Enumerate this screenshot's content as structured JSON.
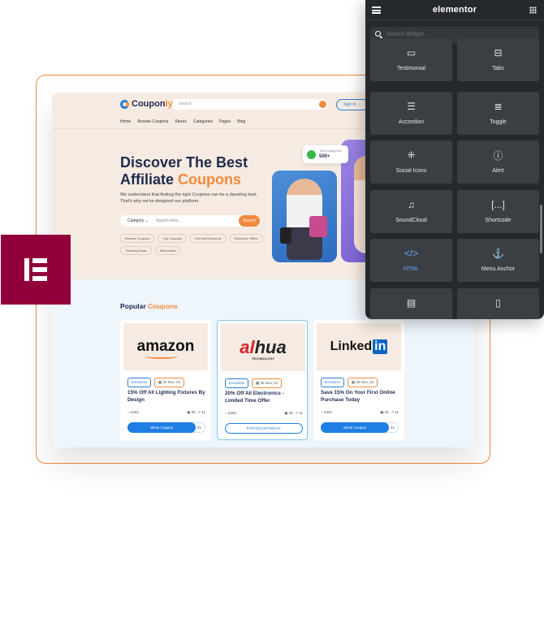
{
  "site": {
    "logo": {
      "text_main": "Coupon",
      "text_accent": "ly"
    },
    "search_placeholder": "Search",
    "signin_label": "Sign In",
    "menu": [
      "Home",
      "Browse Coupons",
      "Stores",
      "Categories",
      "Pages",
      "Blog"
    ],
    "hero": {
      "title_line1": "Discover The Best",
      "title_line2_main": "Affiliate",
      "title_line2_accent": "Coupons",
      "description": "We understand that finding the right Coupons can be a daunting task. That's why we've designed our platform.",
      "search_category": "Category",
      "search_placeholder": "Search here...",
      "search_button": "Search",
      "tags": [
        "Browse Coupons",
        "Top Coupons",
        "Hot and Discounts",
        "Exclusive Offers",
        "Trending Deals",
        "Best Deals"
      ],
      "stat": {
        "label": "Total categories",
        "value": "500+"
      }
    },
    "popular": {
      "title_main": "Popular",
      "title_accent": "Coupons"
    },
    "cards": [
      {
        "brand": "amazon",
        "badge": "Exclusive",
        "date": "25 Nov, 24",
        "title": "15% Off All Lighting Fixtures By Design",
        "uses": "5462",
        "likes": "25",
        "shares": "11",
        "button": "Show Coupon",
        "button_tail": "ifo"
      },
      {
        "brand_main": "hua",
        "brand_accent": "al",
        "brand_sub": "TECHNOLOGY",
        "badge": "Exclusive",
        "date": "25 Nov, 24",
        "title": "20% Off All Electronics - Limited Time Offer",
        "uses": "5462",
        "likes": "25",
        "shares": "11",
        "code": "PGPXDA5PP8SAF"
      },
      {
        "brand_main": "Linked",
        "brand_box": "in",
        "badge": "Exclusive",
        "date": "25 Nov, 24",
        "title": "Save 15% On Your First Online Purchase Today",
        "uses": "5462",
        "likes": "25",
        "shares": "11",
        "button": "Show Coupon",
        "button_tail": "ifo"
      }
    ]
  },
  "panel": {
    "title": "elementor",
    "search_placeholder": "Search Widget...",
    "widgets": [
      {
        "label": "Testimonial",
        "icon": "testimonial-icon",
        "glyph": "▭"
      },
      {
        "label": "Tabs",
        "icon": "tabs-icon",
        "glyph": "⊟"
      },
      {
        "label": "Accordion",
        "icon": "accordion-icon",
        "glyph": "☰"
      },
      {
        "label": "Toggle",
        "icon": "toggle-icon",
        "glyph": "≣"
      },
      {
        "label": "Social Icons",
        "icon": "social-icons-icon",
        "glyph": "⁜"
      },
      {
        "label": "Alert",
        "icon": "alert-icon",
        "glyph": "ⓘ"
      },
      {
        "label": "SoundCloud",
        "icon": "soundcloud-icon",
        "glyph": "♫"
      },
      {
        "label": "Shortcode",
        "icon": "shortcode-icon",
        "glyph": "[...]"
      },
      {
        "label": "HTML",
        "icon": "html-icon",
        "glyph": "</>",
        "active": true
      },
      {
        "label": "Menu Anchor",
        "icon": "menu-anchor-icon",
        "glyph": "⚓"
      },
      {
        "label": "",
        "icon": "sidebar-icon",
        "glyph": "▤"
      },
      {
        "label": "",
        "icon": "text-path-icon",
        "glyph": "▯"
      }
    ]
  },
  "colors": {
    "accent": "#f08a3c",
    "brand_blue": "#2b7cd3",
    "elementor": "#92003b",
    "panel_bg": "#26292c"
  }
}
